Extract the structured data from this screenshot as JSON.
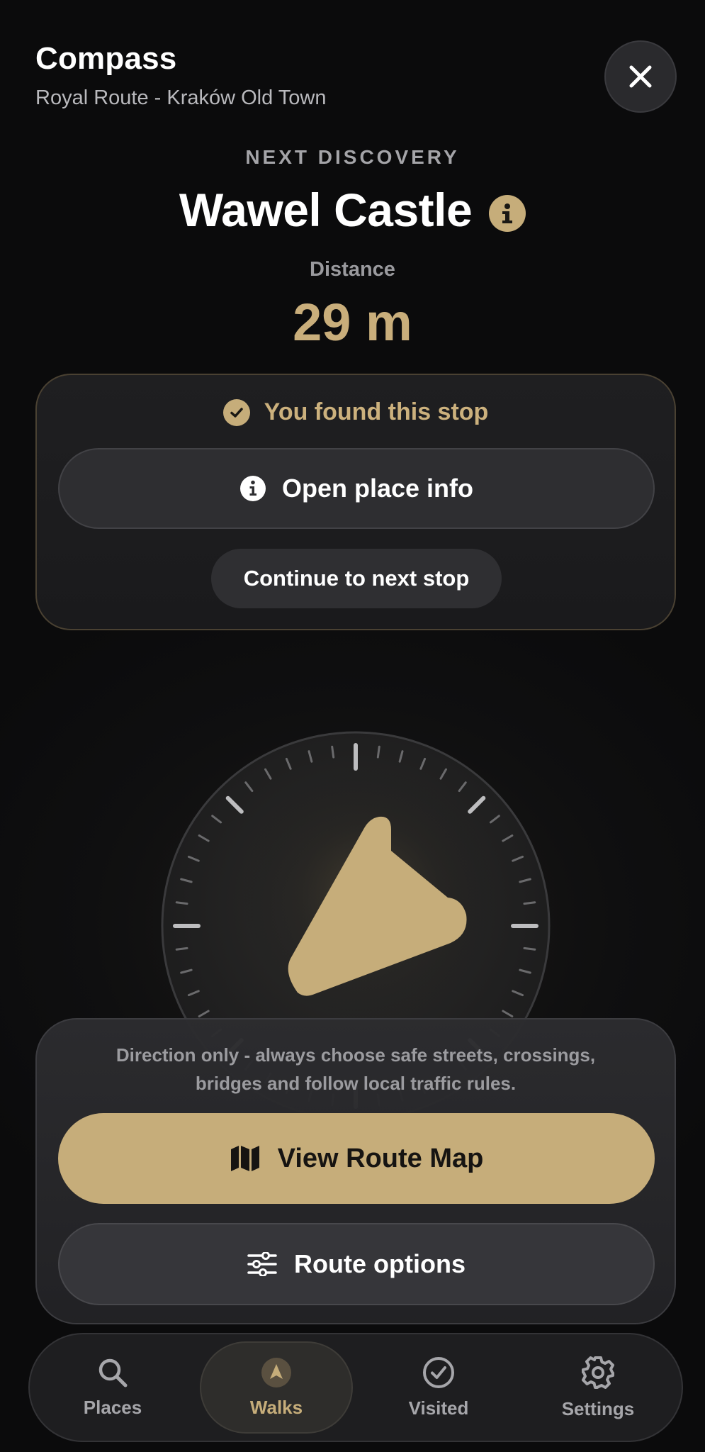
{
  "header": {
    "title": "Compass",
    "subtitle": "Royal Route - Kraków Old Town"
  },
  "discovery": {
    "kicker": "NEXT DISCOVERY",
    "place_name": "Wawel Castle",
    "distance_label": "Distance",
    "distance_value": "29 m"
  },
  "found_card": {
    "status": "You found this stop",
    "open_info_label": "Open place info",
    "continue_label": "Continue to next stop"
  },
  "compass": {
    "heading_note": "arrow points up-right (northeast)"
  },
  "bottom_sheet": {
    "safety_note_line1": "Direction only - always choose safe streets, crossings,",
    "safety_note_line2": "bridges and follow local traffic rules.",
    "view_map_label": "View Route Map",
    "route_options_label": "Route options"
  },
  "tab_bar": {
    "tabs": [
      {
        "label": "Places",
        "icon": "search-icon",
        "active": false
      },
      {
        "label": "Walks",
        "icon": "navigation-arrow-icon",
        "active": true
      },
      {
        "label": "Visited",
        "icon": "check-circle-icon",
        "active": false
      },
      {
        "label": "Settings",
        "icon": "gear-icon",
        "active": false
      }
    ]
  },
  "colors": {
    "accent": "#c6ad7a",
    "background": "#0c0c0e",
    "card": "#1f1f21",
    "muted_text": "#9b9b9f"
  }
}
